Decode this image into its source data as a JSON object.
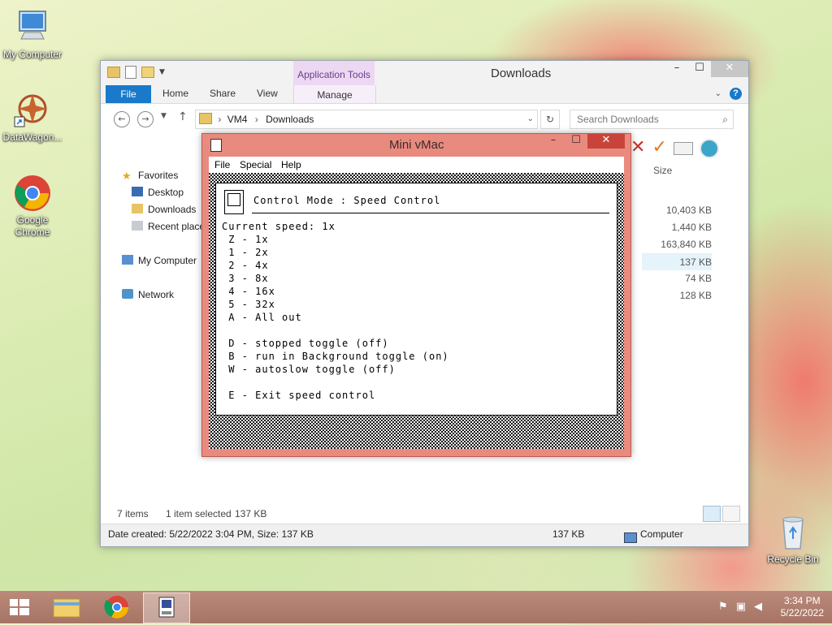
{
  "desktop": {
    "icons": [
      {
        "label": "My Computer"
      },
      {
        "label": "DataWagon..."
      },
      {
        "label": "Google Chrome"
      },
      {
        "label": "Recycle Bin"
      }
    ]
  },
  "explorer": {
    "title": "Downloads",
    "contextual_group": "Application Tools",
    "tabs": {
      "file": "File",
      "home": "Home",
      "share": "Share",
      "view": "View",
      "manage": "Manage"
    },
    "address": {
      "segments": [
        "VM4",
        "Downloads"
      ]
    },
    "search": {
      "placeholder": "Search Downloads"
    },
    "nav": {
      "favorites": "Favorites",
      "desktop": "Desktop",
      "downloads": "Downloads",
      "recent": "Recent places",
      "computer": "My Computer",
      "network": "Network"
    },
    "size_column": "Size",
    "sizes": [
      "10,403 KB",
      "1,440 KB",
      "163,840 KB",
      "137 KB",
      "74 KB",
      "128 KB"
    ],
    "selected_row_index": 3,
    "status": {
      "items": "7 items",
      "selected": "1 item selected",
      "selected_size": "137 KB"
    },
    "details": {
      "created": "Date created: 5/22/2022 3:04 PM, Size: 137 KB",
      "size": "137 KB",
      "location": "Computer"
    }
  },
  "vmac": {
    "title": "Mini vMac",
    "menu": {
      "file": "File",
      "special": "Special",
      "help": "Help"
    },
    "header": "Control Mode : Speed Control",
    "lines": [
      "Current speed: 1x",
      " Z - 1x",
      " 1 - 2x",
      " 2 - 4x",
      " 3 - 8x",
      " 4 - 16x",
      " 5 - 32x",
      " A - All out",
      "",
      " D - stopped toggle (off)",
      " B - run in Background toggle (on)",
      " W - autoslow toggle (off)",
      "",
      " E - Exit speed control"
    ]
  },
  "taskbar": {
    "time": "3:34 PM",
    "date": "5/22/2022"
  },
  "colors": {
    "vmac_frame": "#e98a7f",
    "ribbon_file": "#1979ca",
    "taskbar": "#a67464"
  }
}
